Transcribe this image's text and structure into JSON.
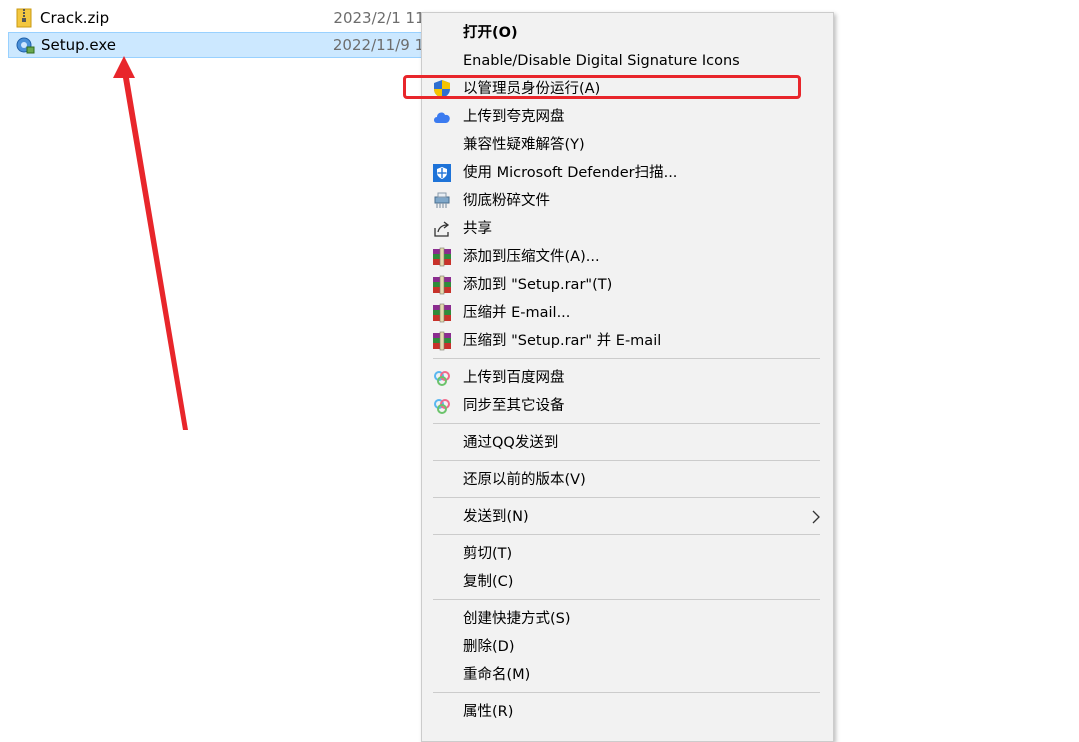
{
  "files": [
    {
      "name": "Crack.zip",
      "date": "2023/2/1 11",
      "icon": "zip-folder-icon",
      "selected": false
    },
    {
      "name": "Setup.exe",
      "date": "2022/11/9 1",
      "icon": "setup-exe-icon",
      "selected": true
    }
  ],
  "menu": {
    "items": [
      {
        "label": "打开(O)",
        "bold": true,
        "icon": ""
      },
      {
        "label": "Enable/Disable Digital Signature Icons",
        "icon": ""
      },
      {
        "label": "以管理员身份运行(A)",
        "icon": "uac-shield-icon"
      },
      {
        "label": "上传到夸克网盘",
        "icon": "quark-cloud-icon"
      },
      {
        "label": "兼容性疑难解答(Y)",
        "icon": ""
      },
      {
        "label": "使用 Microsoft Defender扫描...",
        "icon": "defender-shield-icon"
      },
      {
        "label": "彻底粉碎文件",
        "icon": "shredder-icon"
      },
      {
        "label": "共享",
        "icon": "share-icon"
      },
      {
        "label": "添加到压缩文件(A)...",
        "icon": "winrar-icon"
      },
      {
        "label": "添加到 \"Setup.rar\"(T)",
        "icon": "winrar-icon"
      },
      {
        "label": "压缩并 E-mail...",
        "icon": "winrar-icon"
      },
      {
        "label": "压缩到 \"Setup.rar\" 并 E-mail",
        "icon": "winrar-icon"
      },
      {
        "label": "上传到百度网盘",
        "icon": "baidu-netdisk-icon"
      },
      {
        "label": "同步至其它设备",
        "icon": "baidu-netdisk-icon"
      },
      {
        "label": "通过QQ发送到",
        "icon": ""
      },
      {
        "label": "还原以前的版本(V)",
        "icon": ""
      },
      {
        "label": "发送到(N)",
        "icon": "",
        "submenu": true
      },
      {
        "label": "剪切(T)",
        "icon": ""
      },
      {
        "label": "复制(C)",
        "icon": ""
      },
      {
        "label": "创建快捷方式(S)",
        "icon": ""
      },
      {
        "label": "删除(D)",
        "icon": ""
      },
      {
        "label": "重命名(M)",
        "icon": ""
      },
      {
        "label": "属性(R)",
        "icon": ""
      }
    ]
  },
  "colors": {
    "selection_bg": "#cce8ff",
    "menu_bg": "#f2f2f2",
    "annotation_red": "#e8262b"
  }
}
